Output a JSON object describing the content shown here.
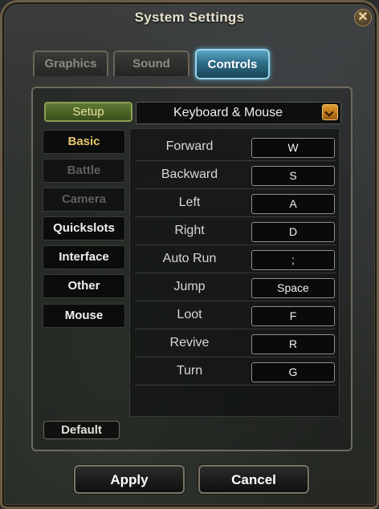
{
  "window": {
    "title": "System Settings",
    "close_glyph": "✕"
  },
  "tabs": [
    {
      "label": "Graphics",
      "active": false
    },
    {
      "label": "Sound",
      "active": false
    },
    {
      "label": "Controls",
      "active": true
    }
  ],
  "setup": {
    "label": "Setup",
    "selected": "Keyboard & Mouse"
  },
  "categories": [
    {
      "label": "Basic",
      "state": "selected"
    },
    {
      "label": "Battle",
      "state": "disabled"
    },
    {
      "label": "Camera",
      "state": "disabled"
    },
    {
      "label": "Quickslots",
      "state": "normal"
    },
    {
      "label": "Interface",
      "state": "normal"
    },
    {
      "label": "Other",
      "state": "normal"
    },
    {
      "label": "Mouse",
      "state": "normal"
    }
  ],
  "bindings": [
    {
      "action": "Forward",
      "key": "W"
    },
    {
      "action": "Backward",
      "key": "S"
    },
    {
      "action": "Left",
      "key": "A"
    },
    {
      "action": "Right",
      "key": "D"
    },
    {
      "action": "Auto Run",
      "key": ";"
    },
    {
      "action": "Jump",
      "key": "Space"
    },
    {
      "action": "Loot",
      "key": "F"
    },
    {
      "action": "Revive",
      "key": "R"
    },
    {
      "action": "Turn",
      "key": "G"
    }
  ],
  "footer": {
    "default_label": "Default",
    "apply_label": "Apply",
    "cancel_label": "Cancel"
  },
  "colors": {
    "active_tab": "#2d6d88",
    "selected_category": "#e8c56a",
    "setup_green": "#607a34"
  }
}
